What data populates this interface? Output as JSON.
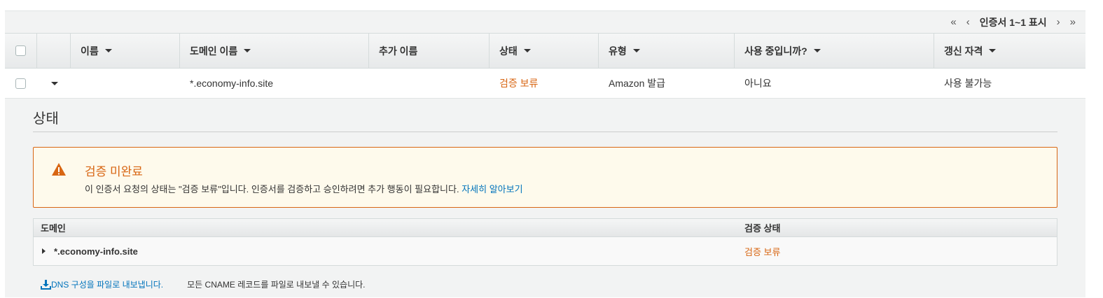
{
  "pagination": {
    "first": "«",
    "prev": "‹",
    "range": "인증서 1~1 표시",
    "next": "›",
    "last": "»"
  },
  "table": {
    "columns": [
      "이름",
      "도메인 이름",
      "추가 이름",
      "상태",
      "유형",
      "사용 중입니까?",
      "갱신 자격"
    ],
    "rows": [
      {
        "name": "",
        "domain": "*.economy-info.site",
        "additional": "",
        "status": "검증 보류",
        "type": "Amazon 발급",
        "in_use": "아니요",
        "renewal": "사용 불가능"
      }
    ]
  },
  "detail": {
    "title": "상태",
    "alert": {
      "title": "검증 미완료",
      "text": "이 인증서 요청의 상태는 \"검증 보류\"입니다. 인증서를 검증하고 승인하려면 추가 행동이 필요합니다. ",
      "link": "자세히 알아보기"
    },
    "domain_table": {
      "headers": [
        "도메인",
        "검증 상태"
      ],
      "rows": [
        {
          "domain": "*.economy-info.site",
          "status": "검증 보류"
        }
      ]
    },
    "export_link": "DNS 구성을 파일로 내보냅니다.",
    "export_note": "모든 CNAME 레코드를 파일로 내보낼 수 있습니다."
  },
  "colors": {
    "pending": "#d86613",
    "link": "#0073bb",
    "alert_bg": "#fefaec"
  },
  "icons": {
    "alert": "warning-icon",
    "export": "download-icon"
  }
}
